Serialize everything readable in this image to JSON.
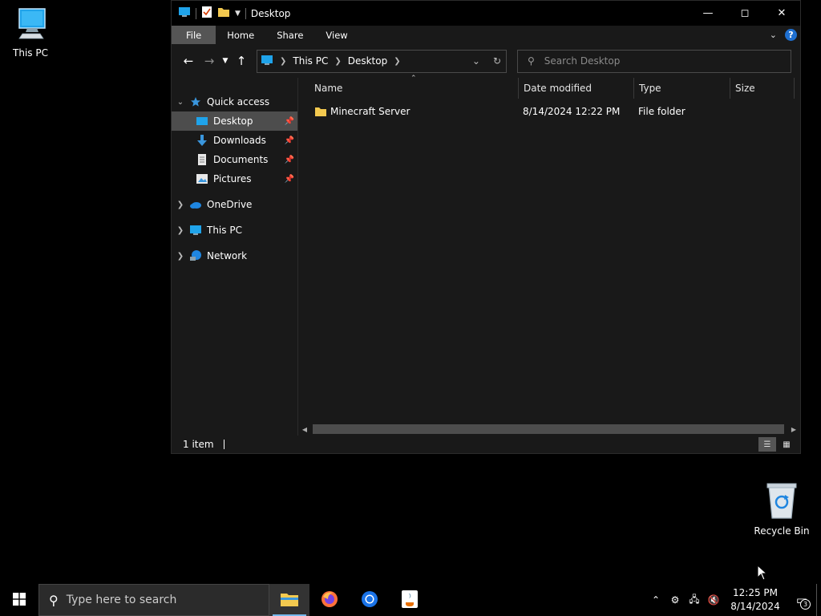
{
  "desktop": {
    "this_pc_label": "This PC",
    "recycle_bin_label": "Recycle Bin"
  },
  "window": {
    "title": "Desktop",
    "ribbon_tabs": [
      "File",
      "Home",
      "Share",
      "View"
    ],
    "address": {
      "crumbs": [
        "This PC",
        "Desktop"
      ]
    },
    "search_placeholder": "Search Desktop",
    "nav": {
      "quick_access": "Quick access",
      "pinned": [
        "Desktop",
        "Downloads",
        "Documents",
        "Pictures"
      ],
      "onedrive": "OneDrive",
      "this_pc": "This PC",
      "network": "Network"
    },
    "columns": [
      "Name",
      "Date modified",
      "Type",
      "Size"
    ],
    "rows": [
      {
        "name": "Minecraft Server",
        "date": "8/14/2024 12:22 PM",
        "type": "File folder",
        "size": ""
      }
    ],
    "status": "1 item"
  },
  "taskbar": {
    "search_placeholder": "Type here to search",
    "time": "12:25 PM",
    "date": "8/14/2024",
    "notification_count": "3"
  },
  "colors": {
    "accent_blue": "#1e6fd0",
    "folder_yellow": "#f3c94f",
    "selection": "#4d4d4d"
  }
}
